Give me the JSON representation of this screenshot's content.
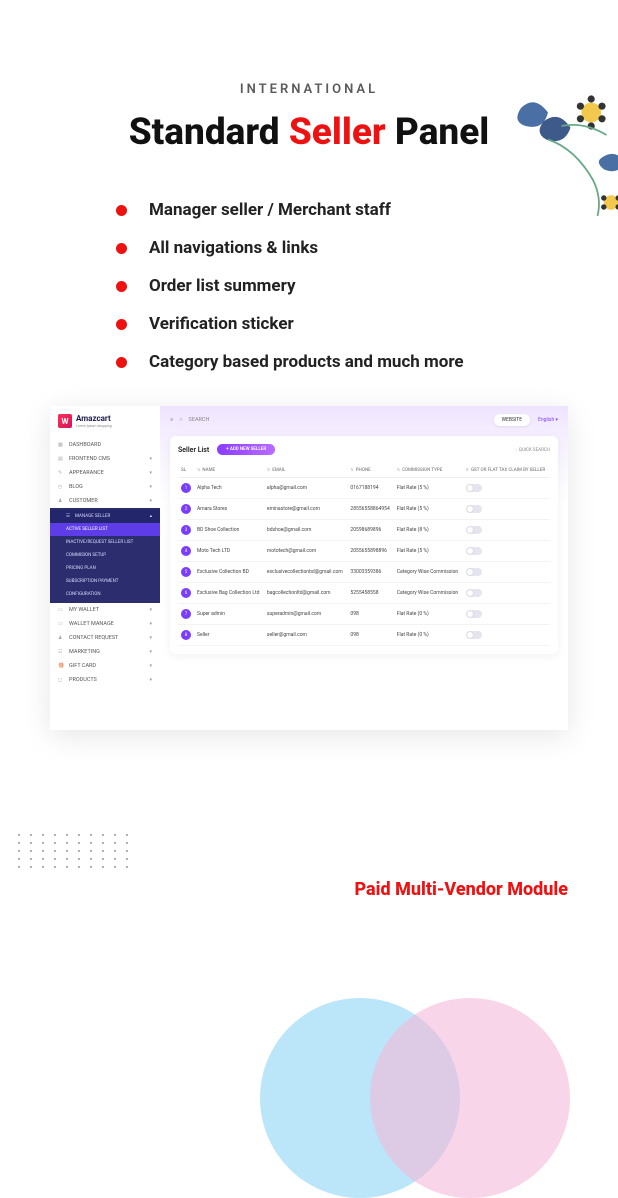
{
  "eyebrow": "INTERNATIONAL",
  "title": {
    "a": "Standard ",
    "b": "Seller",
    "c": " Panel"
  },
  "features": [
    "Manager seller / Merchant staff",
    "All navigations & links",
    "Order list summery",
    "Verification sticker",
    "Category based products and much more"
  ],
  "brand": {
    "name": "Amazcart",
    "sub": "Lorem ipsum shopping"
  },
  "search_label": "SEARCH",
  "website_label": "WEBSITE",
  "lang_label": "English ▾",
  "nav": [
    {
      "icon": "▦",
      "label": "DASHBOARD",
      "chev": ""
    },
    {
      "icon": "▤",
      "label": "FRONTEND CMS",
      "chev": "▾"
    },
    {
      "icon": "✎",
      "label": "APPEARANCE",
      "chev": "▾"
    },
    {
      "icon": "◴",
      "label": "BLOG",
      "chev": "▾"
    },
    {
      "icon": "♟",
      "label": "CUSTOMER",
      "chev": "▾"
    }
  ],
  "submenu_header": {
    "icon": "☰",
    "label": "MANAGE SELLER",
    "chev": "▴"
  },
  "submenu": [
    {
      "label": "ACTIVE SELLER LIST",
      "active": true
    },
    {
      "label": "INACTIVE/REQUEST SELLER LIST"
    },
    {
      "label": "COMMISION SETUP"
    },
    {
      "label": "PRICING PLAN"
    },
    {
      "label": "SUBSCRIPTION PAYMENT"
    },
    {
      "label": "CONFIGURATION"
    }
  ],
  "nav2": [
    {
      "icon": "▭",
      "label": "MY WALLET",
      "chev": "▾"
    },
    {
      "icon": "▭",
      "label": "WALLET MANAGE",
      "chev": "▾"
    },
    {
      "icon": "♟",
      "label": "CONTACT REQUEST",
      "chev": "▾"
    },
    {
      "icon": "☷",
      "label": "MARKETING",
      "chev": "▾"
    },
    {
      "icon": "🎁",
      "label": "GIFT CARD",
      "chev": "▾"
    },
    {
      "icon": "◻",
      "label": "PRODUCTS",
      "chev": "▾"
    }
  ],
  "card_title": "Seller List",
  "add_btn": "+ ADD NEW SELLER",
  "quick_search": "◌ QUICK SEARCH",
  "cols": [
    "SL",
    "NAME",
    "EMAIL",
    "PHONE",
    "COMMISSION TYPE",
    "GST OR FLAT TAX CLAIM BY SELLER"
  ],
  "rows": [
    {
      "sl": "1",
      "name": "Alpha Tech",
      "email": "alpha@gmail.com",
      "phone": "0167188194",
      "comm": "Flat Rate (5 %)"
    },
    {
      "sl": "2",
      "name": "Amara Stores",
      "email": "eminastore@gmail.com",
      "phone": "28556558864954",
      "comm": "Flat Rate (5 %)"
    },
    {
      "sl": "3",
      "name": "BD Shoe Collection",
      "email": "bdshoe@gmail.com",
      "phone": "20598689896",
      "comm": "Flat Rate (8 %)"
    },
    {
      "sl": "4",
      "name": "Moto Tech LTD",
      "email": "mototech@gmail.com",
      "phone": "2055655898896",
      "comm": "Flat Rate (5 %)"
    },
    {
      "sl": "5",
      "name": "Exclusive Collection BD",
      "email": "exclusivecollectionbd@gmail.com",
      "phone": "33003359386",
      "comm": "Category Wise Commission"
    },
    {
      "sl": "6",
      "name": "Exclusive Bag Collection Ltd",
      "email": "bagcollectionltd@gmail.com",
      "phone": "5255458558",
      "comm": "Category Wise Commission"
    },
    {
      "sl": "7",
      "name": "Super admin",
      "email": "superadmin@gmail.com",
      "phone": "098",
      "comm": "Flat Rate (0 %)"
    },
    {
      "sl": "8",
      "name": "Seller",
      "email": "seller@gmail.com",
      "phone": "098",
      "comm": "Flat Rate (0 %)"
    }
  ],
  "footer": "Paid Multi-Vendor Module"
}
